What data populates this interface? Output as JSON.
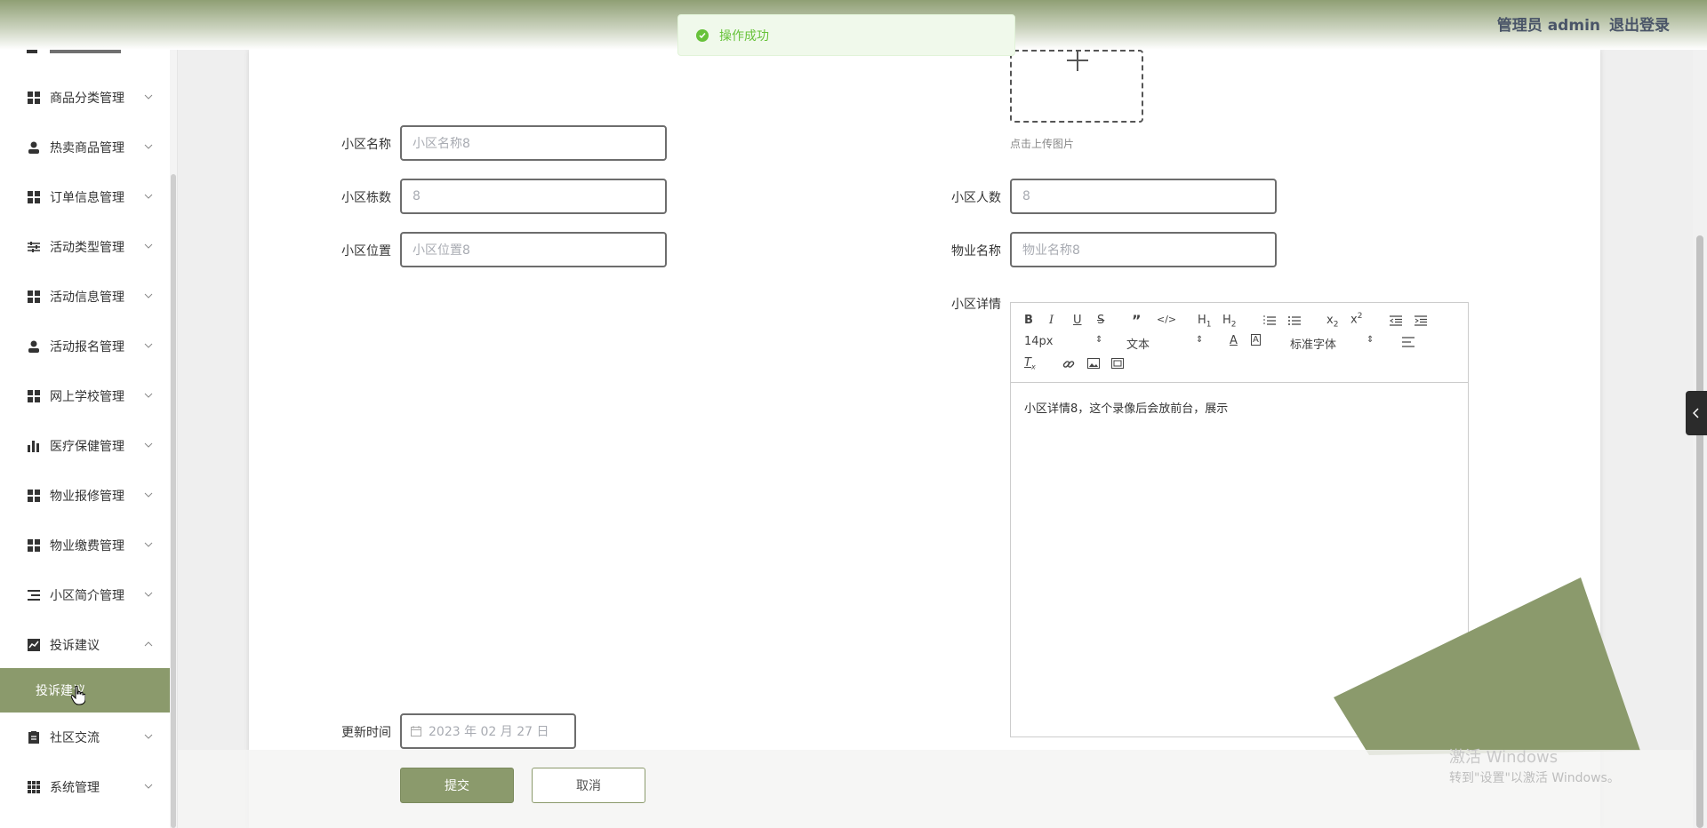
{
  "header": {
    "admin_label": "管理员 admin",
    "logout_label": "退出登录"
  },
  "toast": {
    "message": "操作成功"
  },
  "sidebar": {
    "items": [
      {
        "label": "商品分类管理",
        "icon": "grid-icon"
      },
      {
        "label": "热卖商品管理",
        "icon": "user-icon"
      },
      {
        "label": "订单信息管理",
        "icon": "grid-icon"
      },
      {
        "label": "活动类型管理",
        "icon": "sliders-icon"
      },
      {
        "label": "活动信息管理",
        "icon": "grid-icon"
      },
      {
        "label": "活动报名管理",
        "icon": "user-icon"
      },
      {
        "label": "网上学校管理",
        "icon": "grid-icon"
      },
      {
        "label": "医疗保健管理",
        "icon": "bar-chart-icon"
      },
      {
        "label": "物业报修管理",
        "icon": "grid-icon"
      },
      {
        "label": "物业缴费管理",
        "icon": "grid-icon"
      },
      {
        "label": "小区简介管理",
        "icon": "list-icon"
      },
      {
        "label": "投诉建议",
        "icon": "trend-icon"
      },
      {
        "label": "社区交流",
        "icon": "clipboard-icon"
      },
      {
        "label": "系统管理",
        "icon": "apps-icon"
      }
    ],
    "active_sub": "投诉建议"
  },
  "form": {
    "upload_hint": "点击上传图片",
    "name_label": "小区名称",
    "name_placeholder": "小区名称8",
    "buildings_label": "小区栋数",
    "buildings_value": "8",
    "population_label": "小区人数",
    "population_value": "8",
    "location_label": "小区位置",
    "location_placeholder": "小区位置8",
    "property_label": "物业名称",
    "property_placeholder": "物业名称8",
    "detail_label": "小区详情",
    "detail_content": "小区详情8，这个录像后会放前台，展示",
    "update_label": "更新时间",
    "update_value": "2023 年 02 月 27 日",
    "submit_label": "提交",
    "cancel_label": "取消"
  },
  "editor": {
    "font_size": "14px",
    "text_style": "文本",
    "font_family": "标准字体"
  },
  "watermark": {
    "line1": "激活 Windows",
    "line2": "转到\"设置\"以激活 Windows。"
  },
  "colors": {
    "accent": "#8b9a6c",
    "success": "#67c23a"
  }
}
